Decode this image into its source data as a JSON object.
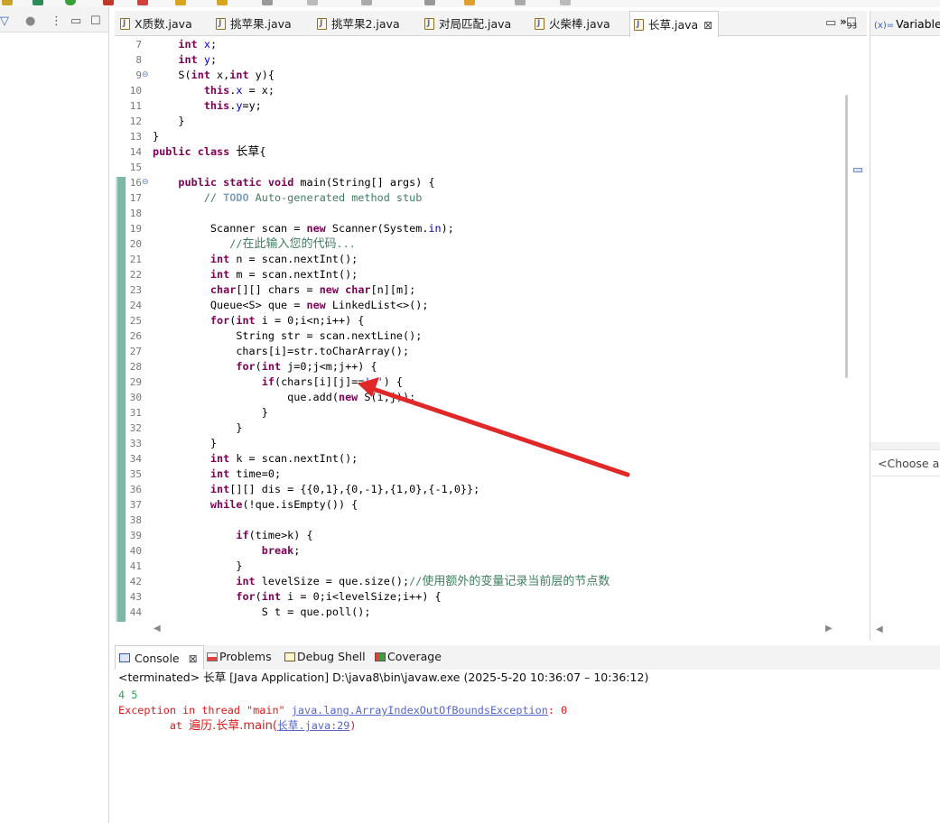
{
  "editor_tabs": [
    {
      "label": "X质数.java"
    },
    {
      "label": "挑苹果.java"
    },
    {
      "label": "挑苹果2.java"
    },
    {
      "label": "对局匹配.java"
    },
    {
      "label": "火柴棒.java"
    },
    {
      "label": "长草.java",
      "active": true
    }
  ],
  "more_tabs": {
    "glyph": "»",
    "count": "93"
  },
  "right_pane": {
    "title": "Variables",
    "choose_placeholder": "<Choose a p"
  },
  "editor_lines": [
    {
      "n": "7",
      "fold": "",
      "html": "    <span class=\"kw\">int</span> <span class=\"fld\">x</span>;"
    },
    {
      "n": "8",
      "fold": "",
      "html": "    <span class=\"kw\">int</span> <span class=\"fld\">y</span>;"
    },
    {
      "n": "9",
      "fold": "⊖",
      "html": "    S(<span class=\"kw\">int</span> x,<span class=\"kw\">int</span> y){"
    },
    {
      "n": "10",
      "fold": "",
      "html": "        <span class=\"kw\">this</span>.<span class=\"fld\">x</span> = x;"
    },
    {
      "n": "11",
      "fold": "",
      "html": "        <span class=\"kw\">this</span>.<span class=\"fld\">y</span>=y;"
    },
    {
      "n": "12",
      "fold": "",
      "html": "    }"
    },
    {
      "n": "13",
      "fold": "",
      "html": "}"
    },
    {
      "n": "14",
      "fold": "",
      "html": "<span class=\"kw\">public</span> <span class=\"kw\">class</span> <span class=\"cjk\">长草</span>{"
    },
    {
      "n": "15",
      "fold": "",
      "html": ""
    },
    {
      "n": "16",
      "fold": "⊖",
      "html": "    <span class=\"kw\">public</span> <span class=\"kw\">static</span> <span class=\"kw\">void</span> main(String[] args) {"
    },
    {
      "n": "17",
      "fold": "",
      "html": "        <span class=\"cm\">// <span class=\"task\">TODO</span> Auto-generated method stub</span>"
    },
    {
      "n": "18",
      "fold": "",
      "html": ""
    },
    {
      "n": "19",
      "fold": "",
      "html": "         Scanner scan = <span class=\"kw\">new</span> Scanner(System.<span class=\"fld\">in</span>);"
    },
    {
      "n": "20",
      "fold": "",
      "html": "            <span class=\"cm\">//<span class=\"cjk\">在此输入您的代码</span>...</span>"
    },
    {
      "n": "21",
      "fold": "",
      "html": "         <span class=\"kw\">int</span> n = scan.nextInt();"
    },
    {
      "n": "22",
      "fold": "",
      "html": "         <span class=\"kw\">int</span> m = scan.nextInt();"
    },
    {
      "n": "23",
      "fold": "",
      "html": "         <span class=\"kw\">char</span>[][] chars = <span class=\"kw\">new</span> <span class=\"kw\">char</span>[n][m];"
    },
    {
      "n": "24",
      "fold": "",
      "html": "         Queue&lt;S&gt; que = <span class=\"kw\">new</span> LinkedList&lt;&gt;();"
    },
    {
      "n": "25",
      "fold": "",
      "html": "         <span class=\"kw\">for</span>(<span class=\"kw\">int</span> i = 0;i&lt;n;i++) {"
    },
    {
      "n": "26",
      "fold": "",
      "html": "             String str = scan.nextLine();"
    },
    {
      "n": "27",
      "fold": "",
      "html": "             chars[i]=str.toCharArray();"
    },
    {
      "n": "28",
      "fold": "",
      "html": "             <span class=\"kw\">for</span>(<span class=\"kw\">int</span> j=0;j&lt;m;j++) {"
    },
    {
      "n": "29",
      "fold": "",
      "html": "                 <span class=\"kw\">if</span>(chars[i][j]==<span class=\"str\">'g'</span>) {"
    },
    {
      "n": "30",
      "fold": "",
      "html": "                     que.add(<span class=\"kw\">new</span> S(i,j));"
    },
    {
      "n": "31",
      "fold": "",
      "html": "                 }"
    },
    {
      "n": "32",
      "fold": "",
      "html": "             }"
    },
    {
      "n": "33",
      "fold": "",
      "html": "         }"
    },
    {
      "n": "34",
      "fold": "",
      "html": "         <span class=\"kw\">int</span> k = scan.nextInt();"
    },
    {
      "n": "35",
      "fold": "",
      "html": "         <span class=\"kw\">int</span> time=0;"
    },
    {
      "n": "36",
      "fold": "",
      "html": "         <span class=\"kw\">int</span>[][] dis = {{0,1},{0,-1},{1,0},{-1,0}};"
    },
    {
      "n": "37",
      "fold": "",
      "html": "         <span class=\"kw\">while</span>(!que.isEmpty()) {"
    },
    {
      "n": "38",
      "fold": "",
      "html": ""
    },
    {
      "n": "39",
      "fold": "",
      "html": "             <span class=\"kw\">if</span>(time&gt;k) {"
    },
    {
      "n": "40",
      "fold": "",
      "html": "                 <span class=\"kw\">break</span>;"
    },
    {
      "n": "41",
      "fold": "",
      "html": "             }"
    },
    {
      "n": "42",
      "fold": "",
      "html": "             <span class=\"kw\">int</span> levelSize = que.size();<span class=\"cm\">//<span class=\"cjk\">使用额外的变量记录当前层的节点数</span></span>"
    },
    {
      "n": "43",
      "fold": "",
      "html": "             <span class=\"kw\">for</span>(<span class=\"kw\">int</span> i = 0;i&lt;levelSize;i++) {"
    },
    {
      "n": "44",
      "fold": "",
      "html": "                 S t = que.poll();"
    }
  ],
  "bottom_tabs": [
    {
      "label": "Console",
      "active": true
    },
    {
      "label": "Problems"
    },
    {
      "label": "Debug Shell"
    },
    {
      "label": "Coverage"
    }
  ],
  "console": {
    "terminated": "<terminated> 长草 [Java Application] D:\\java8\\bin\\javaw.exe  (2025-5-20 10:36:07 – 10:36:12)",
    "input": "4 5",
    "exception_prefix": "Exception in thread \"main\" ",
    "exception_class": "java.lang.ArrayIndexOutOfBoundsException",
    "exception_suffix": ": 0",
    "at_prefix": "        at ",
    "at_method": "遍历.长草.main(",
    "at_link": "长草.java:29",
    "at_suffix": ")"
  },
  "colors": {
    "keyword": "#7f0055",
    "comment": "#3f7f5f",
    "field": "#0000c0",
    "string": "#2a00ff",
    "error": "#d81b1b",
    "console_input": "#2fa15a",
    "arrow": "#e02828",
    "change_bar": "#7fb7a6"
  }
}
